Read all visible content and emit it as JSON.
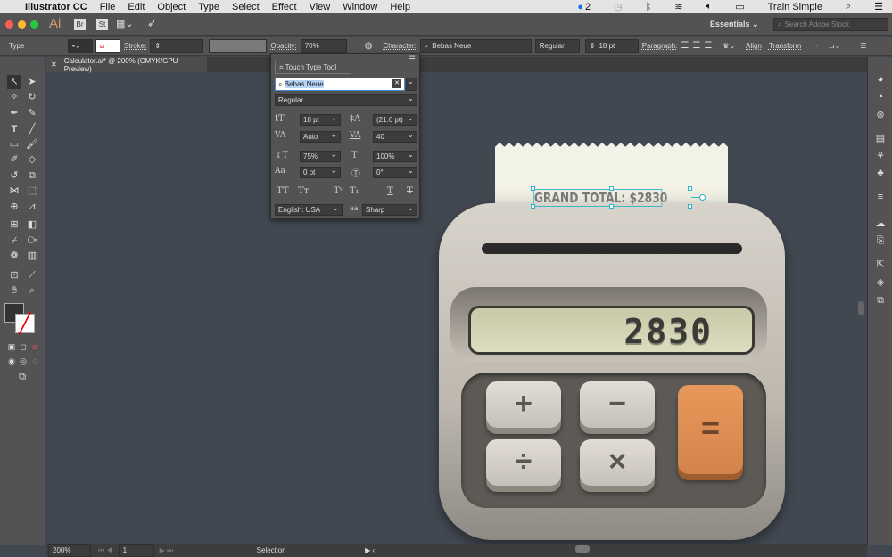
{
  "menubar": {
    "app": "Illustrator CC",
    "items": [
      "File",
      "Edit",
      "Object",
      "Type",
      "Select",
      "Effect",
      "View",
      "Window",
      "Help"
    ],
    "notif_count": "2",
    "user": "Train Simple"
  },
  "appbar": {
    "logo": "Ai",
    "bridge": "Br",
    "stock": "St",
    "workspace": "Essentials",
    "search_placeholder": "Search Adobe Stock"
  },
  "control": {
    "mode": "Type",
    "stroke_label": "Stroke:",
    "opacity_label": "Opacity:",
    "opacity_value": "70%",
    "character_label": "Character:",
    "font": "Bebas Neue",
    "style": "Regular",
    "size": "18 pt",
    "paragraph_label": "Paragraph:",
    "align_label": "Align",
    "transform_label": "Transform"
  },
  "document_tab": {
    "title": "Calculator.ai* @ 200% (CMYK/GPU Preview)"
  },
  "character_panel": {
    "touch_type": "Touch Type Tool",
    "font": "Bebas Neue",
    "style": "Regular",
    "size": "18 pt",
    "leading": "(21.6 pt)",
    "kerning": "Auto",
    "tracking": "40",
    "vscale": "75%",
    "hscale": "100%",
    "baseline": "0 pt",
    "rotation": "0°",
    "language": "English: USA",
    "antialias": "Sharp",
    "aa_icon": "aa"
  },
  "status": {
    "zoom": "200%",
    "artboard": "1",
    "tool": "Selection"
  },
  "artwork": {
    "receipt_text": "GRAND TOTAL: $2830",
    "display": "2830",
    "keys": [
      "+",
      "−",
      "÷",
      "×",
      "="
    ],
    "equals_color": "#e8985a"
  }
}
